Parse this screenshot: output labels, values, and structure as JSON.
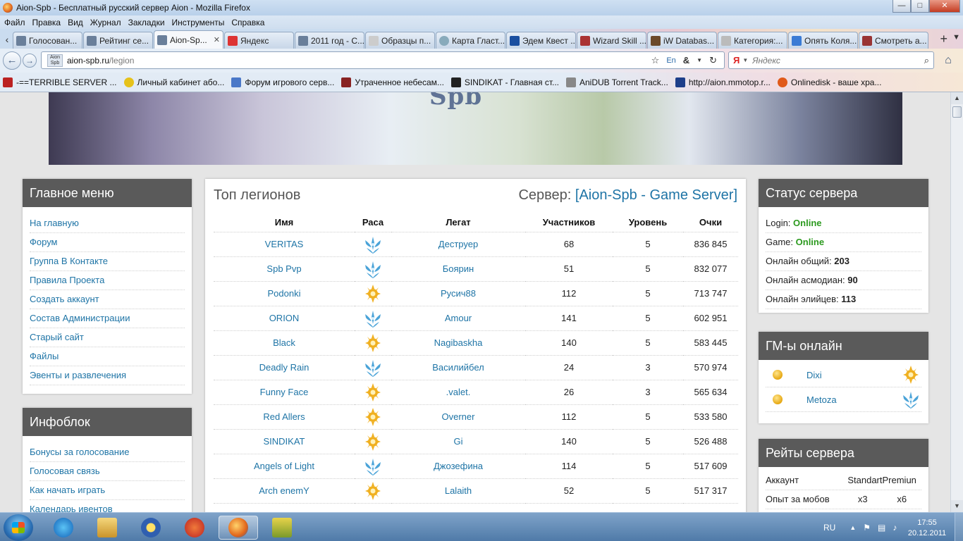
{
  "window": {
    "title": "Aion-Spb - Бесплатный русский сервер Aion - Mozilla Firefox",
    "buttons": {
      "minimize": "—",
      "maximize": "□",
      "close": "✕"
    }
  },
  "menubar": [
    "Файл",
    "Правка",
    "Вид",
    "Журнал",
    "Закладки",
    "Инструменты",
    "Справка"
  ],
  "tabs": [
    {
      "label": "Голосован...",
      "active": false
    },
    {
      "label": "Рейтинг се...",
      "active": false
    },
    {
      "label": "Aion-Sp...",
      "active": true
    },
    {
      "label": "Яндекс",
      "active": false
    },
    {
      "label": "2011 год - С...",
      "active": false
    },
    {
      "label": "Образцы п...",
      "active": false
    },
    {
      "label": "Карта Гласт...",
      "active": false
    },
    {
      "label": "Эдем Квест ...",
      "active": false
    },
    {
      "label": "Wizard Skill ...",
      "active": false
    },
    {
      "label": "iW Databas...",
      "active": false
    },
    {
      "label": "Категория:...",
      "active": false
    },
    {
      "label": "Опять Коля...",
      "active": false
    },
    {
      "label": "Смотреть а...",
      "active": false
    }
  ],
  "tab_controls": {
    "scroll_left": "‹",
    "new_tab": "+",
    "list": "▼",
    "close": "✕"
  },
  "navigation": {
    "back": "←",
    "forward": "→",
    "site_icon_text": "Aion Spb",
    "url_host": "aion-spb.ru",
    "url_path": "/legion",
    "star": "☆",
    "lang": "En",
    "amp": "&",
    "dropdown": "▼",
    "reload": "↻",
    "search_engine": "Я",
    "search_dropdown": "▼",
    "search_placeholder": "Яндекс",
    "search_icon": "⌕",
    "home": "⌂"
  },
  "bookmarks": [
    "-==TERRIBLE SERVER ...",
    "Личный кабинет або...",
    "Форум игрового серв...",
    "Утраченное небесам...",
    "SINDIKAT - Главная ст...",
    "AniDUB Torrent Track...",
    "http://aion.mmotop.r...",
    "Onlinedisk - ваше хра..."
  ],
  "banner": {
    "logo_text": "Spb"
  },
  "left_menu": {
    "title": "Главное меню",
    "items": [
      "На главную",
      "Форум",
      "Группа В Контакте",
      "Правила Проекта",
      "Создать аккаунт",
      "Состав Администрации",
      "Старый сайт",
      "Файлы",
      "Эвенты и развлечения"
    ]
  },
  "infoblock": {
    "title": "Инфоблок",
    "items": [
      "Бонусы за голосование",
      "Голосовая связь",
      "Как начать играть",
      "Календарь ивентов"
    ]
  },
  "legions": {
    "title": "Топ легионов",
    "server_prefix": "Сервер: ",
    "bracket_open": "[",
    "server_name": "Aion-Spb - Game Server",
    "bracket_close": "]",
    "columns": [
      "Имя",
      "Раса",
      "Легат",
      "Участников",
      "Уровень",
      "Очки"
    ],
    "rows": [
      {
        "name": "VERITAS",
        "race": "asmodian",
        "legate": "Деструер",
        "members": "68",
        "level": "5",
        "points": "836 845"
      },
      {
        "name": "Spb Pvp",
        "race": "asmodian",
        "legate": "Боярин",
        "members": "51",
        "level": "5",
        "points": "832 077"
      },
      {
        "name": "Podonki",
        "race": "elyos",
        "legate": "Русич88",
        "members": "112",
        "level": "5",
        "points": "713 747"
      },
      {
        "name": "ORION",
        "race": "asmodian",
        "legate": "Amour",
        "members": "141",
        "level": "5",
        "points": "602 951"
      },
      {
        "name": "Black",
        "race": "elyos",
        "legate": "Nagibaskha",
        "members": "140",
        "level": "5",
        "points": "583 445"
      },
      {
        "name": "Deadly Rain",
        "race": "asmodian",
        "legate": "Василийбел",
        "members": "24",
        "level": "3",
        "points": "570 974"
      },
      {
        "name": "Funny Face",
        "race": "elyos",
        "legate": ".valet.",
        "members": "26",
        "level": "3",
        "points": "565 634"
      },
      {
        "name": "Red Allers",
        "race": "elyos",
        "legate": "Overner",
        "members": "112",
        "level": "5",
        "points": "533 580"
      },
      {
        "name": "SINDIKAT",
        "race": "elyos",
        "legate": "Gi",
        "members": "140",
        "level": "5",
        "points": "526 488"
      },
      {
        "name": "Angels of Light",
        "race": "asmodian",
        "legate": "Джозефина",
        "members": "114",
        "level": "5",
        "points": "517 609"
      },
      {
        "name": "Arch enemY",
        "race": "elyos",
        "legate": "Lalaith",
        "members": "52",
        "level": "5",
        "points": "517 317"
      }
    ]
  },
  "server_status": {
    "title": "Статус сервера",
    "login_label": "Login:",
    "login_value": "Online",
    "game_label": "Game:",
    "game_value": "Online",
    "total_label": "Онлайн общий:",
    "total_value": "203",
    "asmo_label": "Онлайн асмодиан:",
    "asmo_value": "90",
    "ely_label": "Онлайн элийцев:",
    "ely_value": "113"
  },
  "gm_online": {
    "title": "ГМ-ы онлайн",
    "items": [
      {
        "name": "Dixi",
        "race": "elyos"
      },
      {
        "name": "Metoza",
        "race": "asmodian"
      }
    ]
  },
  "rates": {
    "title": "Рейты сервера",
    "rows": [
      {
        "label": "Аккаунт",
        "v1": "Standart",
        "v2": "Premiun"
      },
      {
        "label": "Опыт за мобов",
        "v1": "x3",
        "v2": "x6"
      }
    ]
  },
  "scrollbar": {
    "up": "▲",
    "down": "▼"
  },
  "taskbar": {
    "apps": [
      "ie",
      "explorer",
      "media",
      "ccleaner",
      "firefox",
      "game"
    ],
    "lang": "RU",
    "tray_chevron": "▲",
    "tray_flag": "⚑",
    "tray_network": "▤",
    "tray_volume": "♪",
    "time": "17:55",
    "date": "20.12.2011"
  },
  "colors": {
    "link": "#1e74a6",
    "online": "#2c9a1f",
    "widget_header": "#5a5a5a",
    "elyos": "#f0b020",
    "asmodian": "#4aa3d8"
  }
}
